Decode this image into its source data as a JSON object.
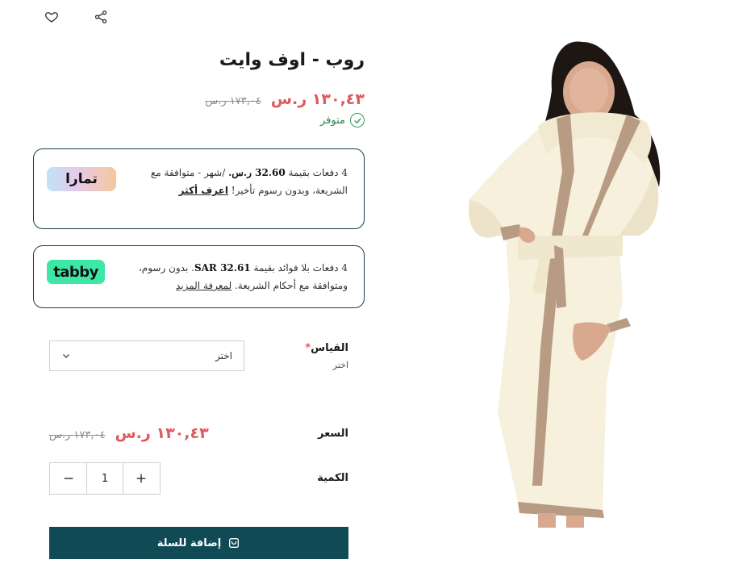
{
  "header": {
    "icons": [
      "share-icon",
      "heart-icon"
    ]
  },
  "product": {
    "title": "روب - اوف وايت",
    "price_new": "١٣٠,٤٣ ر.س",
    "price_old": "١٧٣,٠٤ ر.س",
    "stock_status": "متوفر"
  },
  "tamara": {
    "logo_text": "تمارا",
    "line1_prefix": "4 دفعات بقيمة",
    "amount": "32.60 ر.س.",
    "line1_suffix": "/شهر - متوافقة مع",
    "line2": "الشريعة، وبدون رسوم تأخير!",
    "link": "اعرف أكثر"
  },
  "tabby": {
    "logo_text": "tabby",
    "line1_prefix": "4 دفعات بلا فوائد بقيمة",
    "amount": "SAR 32.61",
    "line1_suffix": ". بدون رسوم،",
    "line2": "ومتوافقة مع أحكام الشريعة.",
    "link": "لمعرفة المزيد"
  },
  "size": {
    "label": "القياس",
    "required_mark": "*",
    "sub_label": "اختر",
    "select_value": "اختر"
  },
  "price_section": {
    "label": "السعر",
    "price_new": "١٣٠,٤٣ ر.س",
    "price_old": "١٧٣,٠٤ ر.س"
  },
  "quantity": {
    "label": "الكمية",
    "value": "1"
  },
  "cart": {
    "button_label": "إضافة للسلة"
  },
  "colors": {
    "accent": "#0f4a55",
    "sale": "#e0595d",
    "in_stock": "#2e7d4f",
    "tabby": "#3de8a6"
  }
}
